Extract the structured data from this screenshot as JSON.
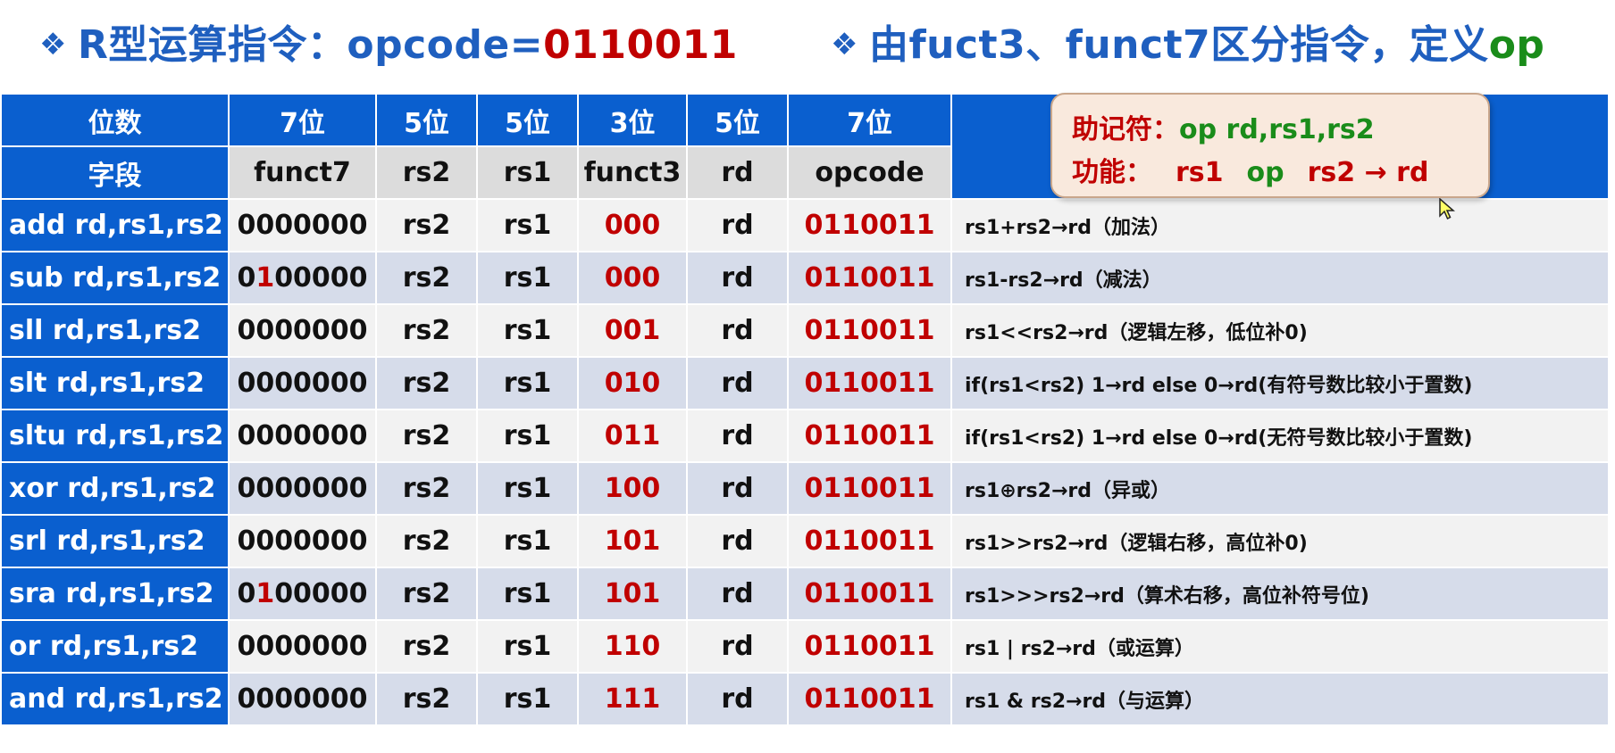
{
  "header": {
    "left_diamond": "❖",
    "left_prefix": "R型运算指令：opcode=",
    "left_code": "0110011",
    "right_diamond": "❖",
    "right_prefix": "由fuct3、funct7区分指令，定义",
    "right_op": "op"
  },
  "note": {
    "mnemonic_label": "助记符：",
    "mnemonic_value": "op rd,rs1,rs2",
    "function_label": "功能：",
    "function_rs1": "rs1",
    "function_op": "op",
    "function_rest": "rs2 → rd"
  },
  "table": {
    "bits_row": [
      "位数",
      "7位",
      "5位",
      "5位",
      "3位",
      "5位",
      "7位"
    ],
    "fields_row": [
      "字段",
      "funct7",
      "rs2",
      "rs1",
      "funct3",
      "rd",
      "opcode"
    ],
    "rows": [
      {
        "instr": "add  rd,rs1,rs2",
        "f7a": "0",
        "f7b": "0",
        "f7c": "00000",
        "rs2": "rs2",
        "rs1": "rs1",
        "funct3": "000",
        "rd": "rd",
        "opcode": "0110011",
        "desc": "rs1+rs2→rd（加法）"
      },
      {
        "instr": "sub  rd,rs1,rs2",
        "f7a": "0",
        "f7b": "1",
        "f7c": "00000",
        "rs2": "rs2",
        "rs1": "rs1",
        "funct3": "000",
        "rd": "rd",
        "opcode": "0110011",
        "desc": "rs1-rs2→rd（减法）"
      },
      {
        "instr": "sll    rd,rs1,rs2",
        "f7a": "0",
        "f7b": "0",
        "f7c": "00000",
        "rs2": "rs2",
        "rs1": "rs1",
        "funct3": "001",
        "rd": "rd",
        "opcode": "0110011",
        "desc": "rs1<<rs2→rd（逻辑左移，低位补0)"
      },
      {
        "instr": "slt   rd,rs1,rs2",
        "f7a": "0",
        "f7b": "0",
        "f7c": "00000",
        "rs2": "rs2",
        "rs1": "rs1",
        "funct3": "010",
        "rd": "rd",
        "opcode": "0110011",
        "desc": "if(rs1<rs2)  1→rd else 0→rd(有符号数比较小于置数)"
      },
      {
        "instr": "sltu rd,rs1,rs2",
        "f7a": "0",
        "f7b": "0",
        "f7c": "00000",
        "rs2": "rs2",
        "rs1": "rs1",
        "funct3": "011",
        "rd": "rd",
        "opcode": "0110011",
        "desc": "if(rs1<rs2)  1→rd else 0→rd(无符号数比较小于置数)"
      },
      {
        "instr": "xor  rd,rs1,rs2",
        "f7a": "0",
        "f7b": "0",
        "f7c": "00000",
        "rs2": "rs2",
        "rs1": "rs1",
        "funct3": "100",
        "rd": "rd",
        "opcode": "0110011",
        "desc": "rs1⊕rs2→rd（异或）"
      },
      {
        "instr": "srl   rd,rs1,rs2",
        "f7a": "0",
        "f7b": "0",
        "f7c": "00000",
        "rs2": "rs2",
        "rs1": "rs1",
        "funct3": "101",
        "rd": "rd",
        "opcode": "0110011",
        "desc": "rs1>>rs2→rd（逻辑右移，高位补0)"
      },
      {
        "instr": "sra  rd,rs1,rs2",
        "f7a": "0",
        "f7b": "1",
        "f7c": "00000",
        "rs2": "rs2",
        "rs1": "rs1",
        "funct3": "101",
        "rd": "rd",
        "opcode": "0110011",
        "desc": "rs1>>>rs2→rd（算术右移，高位补符号位)"
      },
      {
        "instr": "or    rd,rs1,rs2",
        "f7a": "0",
        "f7b": "0",
        "f7c": "00000",
        "rs2": "rs2",
        "rs1": "rs1",
        "funct3": "110",
        "rd": "rd",
        "opcode": "0110011",
        "desc": "rs1 | rs2→rd（或运算）"
      },
      {
        "instr": "and  rd,rs1,rs2",
        "f7a": "0",
        "f7b": "0",
        "f7c": "00000",
        "rs2": "rs2",
        "rs1": "rs1",
        "funct3": "111",
        "rd": "rd",
        "opcode": "0110011",
        "desc": "rs1 & rs2→rd（与运算）"
      }
    ]
  },
  "colors": {
    "header_blue": "#0a5fcf",
    "title_blue": "#1f5fbf",
    "accent_red": "#c00000",
    "accent_green": "#1a8c1a",
    "note_bg": "#f9e9dd"
  },
  "icons": {
    "cursor": "mouse-pointer-icon"
  }
}
